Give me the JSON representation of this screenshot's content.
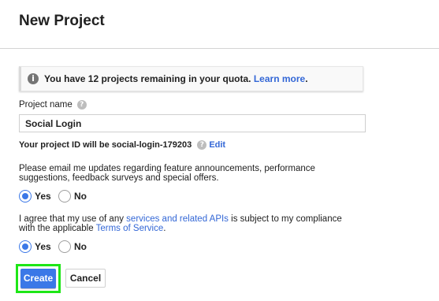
{
  "header": {
    "title": "New Project"
  },
  "quota": {
    "message": "You have 12 projects remaining in your quota.",
    "link": "Learn more",
    "suffix": "."
  },
  "project_name": {
    "label": "Project name",
    "value": "Social Login"
  },
  "project_id": {
    "text": "Your project ID will be social-login-179203",
    "edit": "Edit"
  },
  "email_updates": {
    "question": "Please email me updates regarding feature announcements, performance suggestions, feedback surveys and special offers.",
    "options": [
      "Yes",
      "No"
    ],
    "selected": "Yes"
  },
  "terms": {
    "text_1": "I agree that my use of any ",
    "link_1": "services and related APIs",
    "text_2": " is subject to my compliance with the applicable ",
    "link_2": "Terms of Service",
    "text_3": ".",
    "options": [
      "Yes",
      "No"
    ],
    "selected": "Yes"
  },
  "actions": {
    "create": "Create",
    "cancel": "Cancel"
  },
  "colors": {
    "accent": "#3b78e7",
    "link": "#3367d6",
    "highlight": "#1ee617"
  },
  "icons": {
    "info": "info-icon",
    "help": "help-icon"
  }
}
